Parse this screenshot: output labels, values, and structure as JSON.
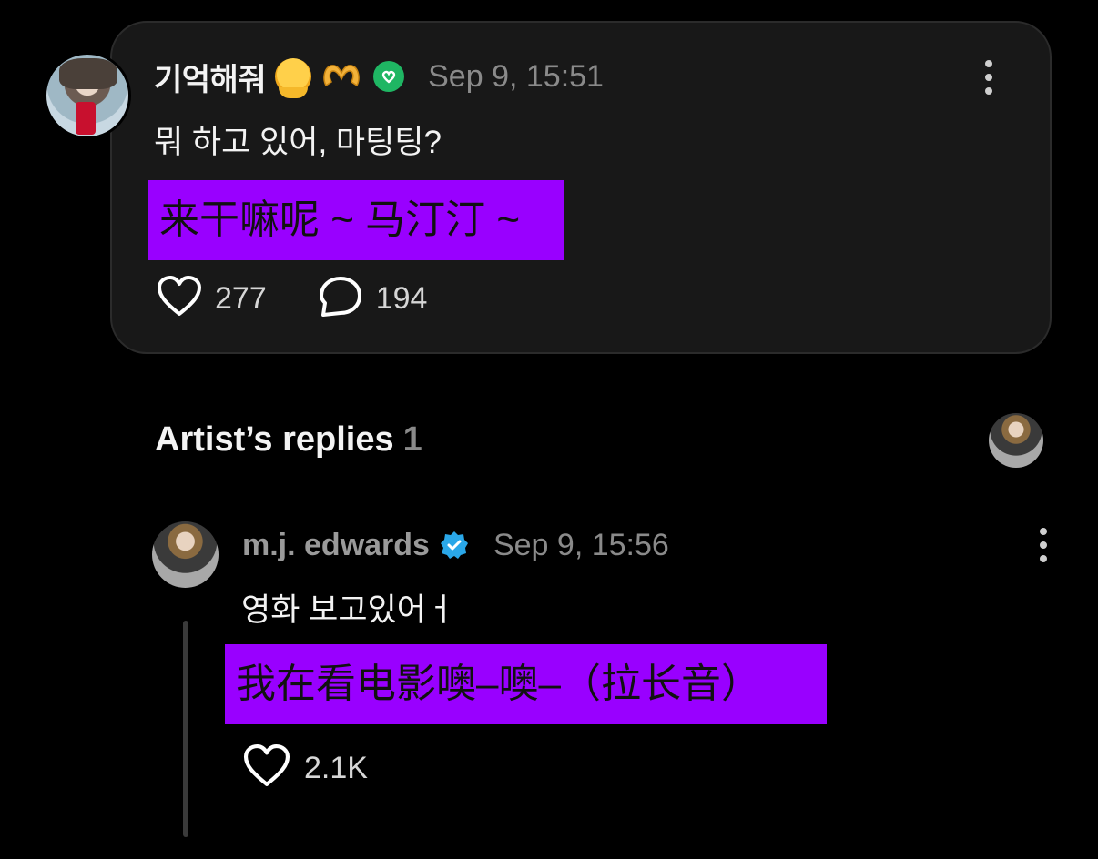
{
  "post": {
    "username": "기억해줘",
    "emoji_1": "melting-face",
    "emoji_2": "heart-hands",
    "timestamp": "Sep 9, 15:51",
    "text": "뭐 하고 있어, 마팅팅?",
    "translation": "来干嘛呢 ~ 马汀汀 ~",
    "likes": "277",
    "comments": "194"
  },
  "replies_section": {
    "title": "Artist’s replies",
    "count": "1"
  },
  "reply": {
    "username": "m.j. edwards",
    "timestamp": "Sep 9, 15:56",
    "text": "영화 보고있어ㅓ",
    "translation": "我在看电影噢–噢–（拉长音）",
    "likes": "2.1K"
  },
  "colors": {
    "background": "#000000",
    "card": "#181818",
    "translation_highlight": "#9900ff",
    "verified_green": "#1fb663",
    "verified_blue": "#2aa7e8",
    "muted_text": "#8a8a8a"
  }
}
